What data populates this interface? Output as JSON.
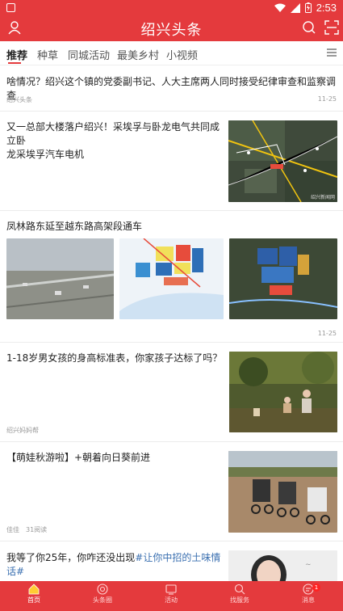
{
  "status": {
    "time": "2:53"
  },
  "header": {
    "title": "绍兴头条"
  },
  "tabs": [
    {
      "label": "推荐"
    },
    {
      "label": "种草"
    },
    {
      "label": "同城活动"
    },
    {
      "label": "最美乡村"
    },
    {
      "label": "小视频"
    }
  ],
  "feed": [
    {
      "title": "啥情况？绍兴这个镇的党委副书记、人大主席两人同时接受纪律审查和监察调查",
      "source": "绍兴头条",
      "date": "11-25"
    },
    {
      "title_line1": "又一总部大楼落户绍兴！采埃孚与卧龙电气共同成立卧",
      "title_line2": "龙采埃孚汽车电机",
      "map_watermark": "绍兴新闻网"
    },
    {
      "title": "凤林路东延至越东路高架段通车",
      "date": "11-25"
    },
    {
      "title": "1-18岁男女孩的身高标准表，你家孩子达标了吗？",
      "source": "绍兴妈妈帮"
    },
    {
      "title": "【萌娃秋游啦】+朝着向日葵前进",
      "source": "佳佳",
      "reads": "31阅读"
    },
    {
      "title_plain": "我等了你25年，你咋还没出现",
      "title_link": "#让你中招的土味情话#"
    }
  ],
  "bottom_nav": [
    {
      "label": "首页"
    },
    {
      "label": "头条圈"
    },
    {
      "label": "活动"
    },
    {
      "label": "找服务"
    },
    {
      "label": "消息",
      "badge": "1"
    }
  ],
  "colors": {
    "brand_red": "#e43a3d"
  },
  "icons": [
    "user-icon",
    "search-icon",
    "scan-icon",
    "menu-icon",
    "home-icon",
    "circle-icon",
    "activity-icon",
    "find-service-icon",
    "message-icon"
  ]
}
